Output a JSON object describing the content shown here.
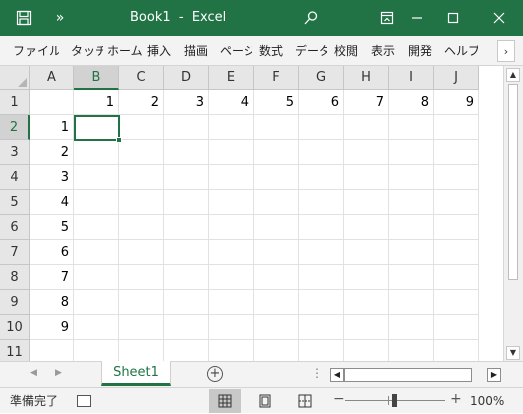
{
  "window": {
    "title": "Book1  -  Excel",
    "colors": {
      "brand": "#217346",
      "grid": "#e1e1e1",
      "header_bg": "#e6e6e6"
    }
  },
  "ribbon": {
    "tabs": [
      "ファイル",
      "タッチ",
      "ホーム",
      "挿入",
      "描画",
      "ページ",
      "数式",
      "データ",
      "校閲",
      "表示",
      "開発",
      "ヘルプ"
    ],
    "more_icon": "chevron-right-icon"
  },
  "grid": {
    "columns": [
      "A",
      "B",
      "C",
      "D",
      "E",
      "F",
      "G",
      "H",
      "I",
      "J"
    ],
    "rows": [
      "1",
      "2",
      "3",
      "4",
      "5",
      "6",
      "7",
      "8",
      "9",
      "10",
      "11"
    ],
    "cells": [
      [
        "",
        "1",
        "2",
        "3",
        "4",
        "5",
        "6",
        "7",
        "8",
        "9"
      ],
      [
        "1",
        "",
        "",
        "",
        "",
        "",
        "",
        "",
        "",
        ""
      ],
      [
        "2",
        "",
        "",
        "",
        "",
        "",
        "",
        "",
        "",
        ""
      ],
      [
        "3",
        "",
        "",
        "",
        "",
        "",
        "",
        "",
        "",
        ""
      ],
      [
        "4",
        "",
        "",
        "",
        "",
        "",
        "",
        "",
        "",
        ""
      ],
      [
        "5",
        "",
        "",
        "",
        "",
        "",
        "",
        "",
        "",
        ""
      ],
      [
        "6",
        "",
        "",
        "",
        "",
        "",
        "",
        "",
        "",
        ""
      ],
      [
        "7",
        "",
        "",
        "",
        "",
        "",
        "",
        "",
        "",
        ""
      ],
      [
        "8",
        "",
        "",
        "",
        "",
        "",
        "",
        "",
        "",
        ""
      ],
      [
        "9",
        "",
        "",
        "",
        "",
        "",
        "",
        "",
        "",
        ""
      ],
      [
        "",
        "",
        "",
        "",
        "",
        "",
        "",
        "",
        "",
        ""
      ]
    ],
    "active_column": "B",
    "active_row": "2"
  },
  "sheets": {
    "tabs": [
      "Sheet1"
    ]
  },
  "status": {
    "text": "準備完了",
    "zoom": "100%"
  }
}
